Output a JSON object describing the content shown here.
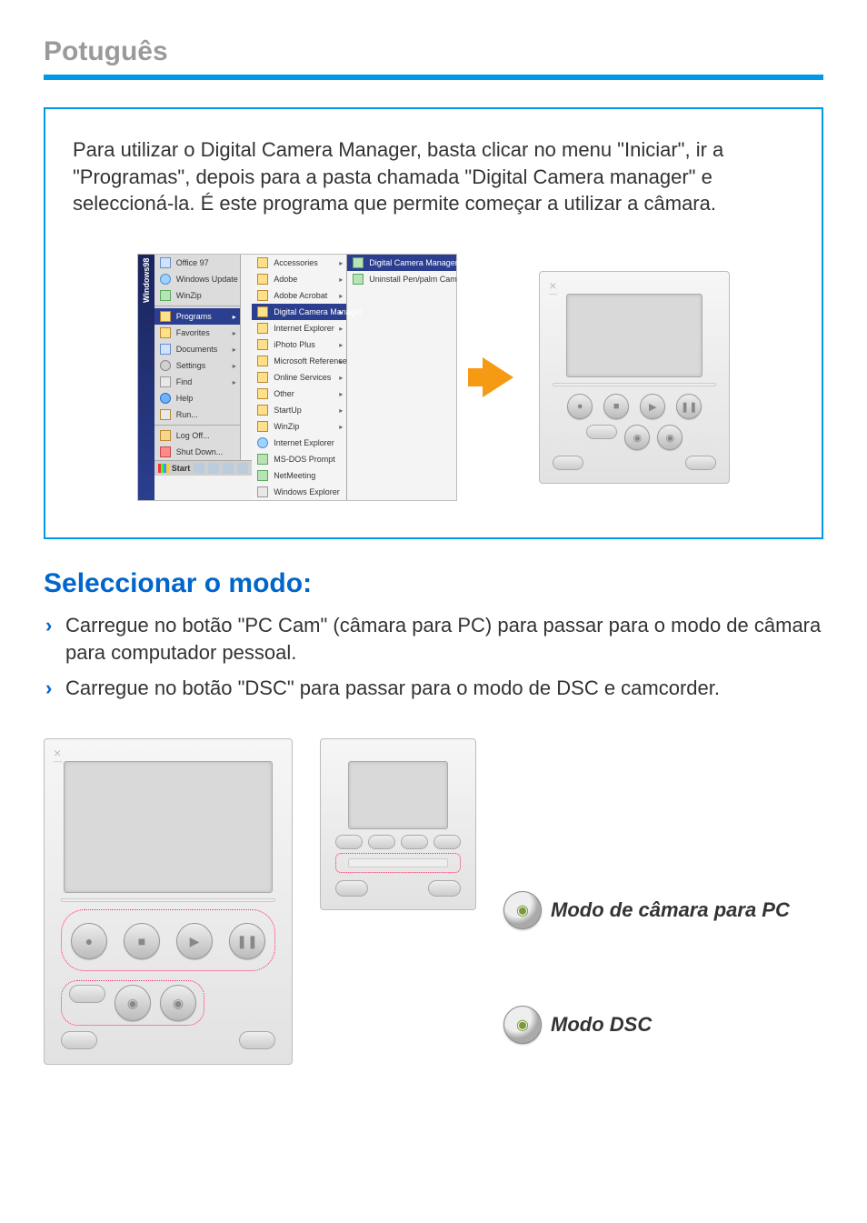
{
  "page": {
    "language_header": "Potuguês"
  },
  "intro_box": {
    "paragraph": "Para utilizar o Digital Camera Manager, basta clicar no menu \"Iniciar\", ir a \"Programas\", depois para a pasta chamada \"Digital Camera manager\" e seleccioná-la. É este programa que permite começar a utilizar a câmara."
  },
  "start_menu": {
    "os_label": "Windows98",
    "top_items": [
      "Office 97",
      "Windows Update",
      "WinZip"
    ],
    "main_items": [
      "Programs",
      "Favorites",
      "Documents",
      "Settings",
      "Find",
      "Help",
      "Run...",
      "Log Off...",
      "Shut Down..."
    ],
    "programs_submenu": [
      "Accessories",
      "Adobe",
      "Adobe Acrobat",
      "Digital Camera Manager",
      "Internet Explorer",
      "iPhoto Plus",
      "Microsoft Reference",
      "Online Services",
      "Other",
      "StartUp",
      "WinZip",
      "Internet Explorer",
      "MS-DOS Prompt",
      "NetMeeting",
      "Windows Explorer"
    ],
    "dcm_submenu": [
      "Digital Camera Manager",
      "Uninstall Pen/palm Cam"
    ],
    "taskbar": {
      "start_label": "Start"
    }
  },
  "section": {
    "heading": "Seleccionar o modo:",
    "bullets": [
      "Carregue no botão \"PC Cam\" (câmara para PC) para passar para o modo de câmara para computador pessoal.",
      "Carregue no botão \"DSC\" para passar para o modo de DSC e camcorder."
    ]
  },
  "modes": {
    "pc_cam": "Modo de câmara para PC",
    "dsc": "Modo DSC"
  },
  "glyphs": {
    "close_x": "×",
    "close_under": "—",
    "play": "▶",
    "pause": "❚❚",
    "stop": "■",
    "rec": "●",
    "knob": "◉"
  }
}
